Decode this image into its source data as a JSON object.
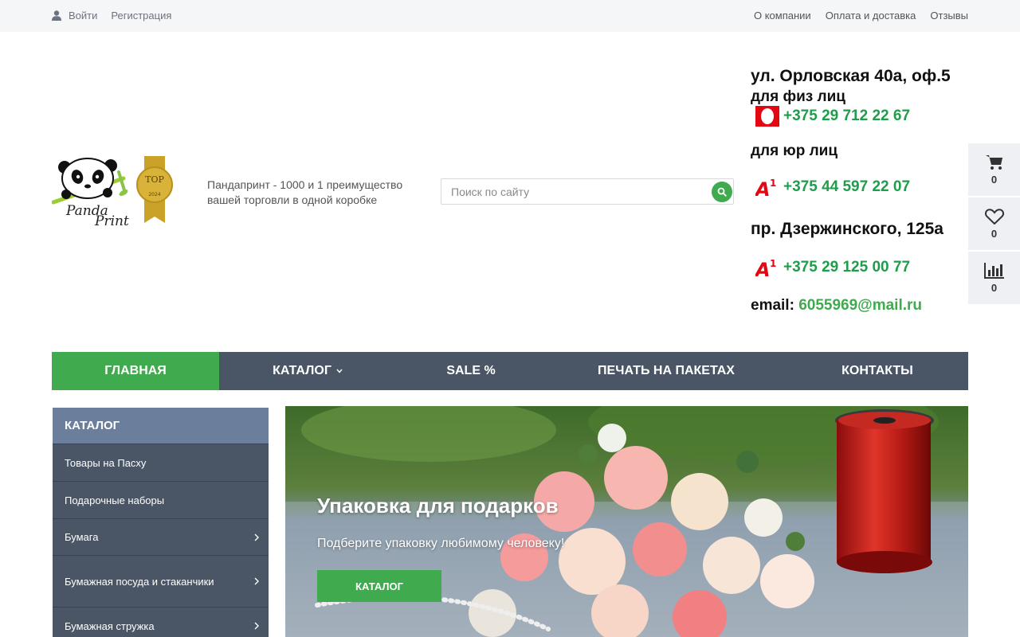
{
  "topbar": {
    "login": "Войти",
    "register": "Регистрация",
    "links": [
      "О компании",
      "Оплата и доставка",
      "Отзывы"
    ]
  },
  "logo": {
    "line1": "Panda",
    "line2": "Print",
    "badge_top": "TOP",
    "badge_year": "2024"
  },
  "tagline": "Пандапринт - 1000 и 1 преимущество вашей торговли в одной коробке",
  "search": {
    "placeholder": "Поиск по сайту"
  },
  "contacts": {
    "address1": "ул. Орловская 40а, оф.5",
    "label_phys": "для физ лиц",
    "phone1": "+375 29 712 22 67",
    "label_jur": "для юр лиц",
    "phone2": "+375 44 597 22 07",
    "address2": "пр. Дзержинского, 125а",
    "phone3": "+375 29 125 00 77",
    "email_label": "email:",
    "email": "6055969@mail.ru"
  },
  "side": {
    "cart_count": "0",
    "fav_count": "0",
    "compare_count": "0"
  },
  "menu": {
    "items": [
      "Главная",
      "Каталог",
      "SALE %",
      "Печать на пакетах",
      "Контакты"
    ]
  },
  "catalog": {
    "title": "Каталог",
    "items": [
      "Товары на Пасху",
      "Подарочные наборы",
      "Бумага",
      "Бумажная посуда и стаканчики",
      "Бумажная стружка"
    ]
  },
  "banner": {
    "title": "Упаковка для подарков",
    "subtitle": "Подберите упаковку любимому человеку!",
    "button": "Каталог"
  },
  "colors": {
    "accent": "#3faa4e",
    "menu": "#4a5566",
    "phone": "#1f9d4b"
  }
}
